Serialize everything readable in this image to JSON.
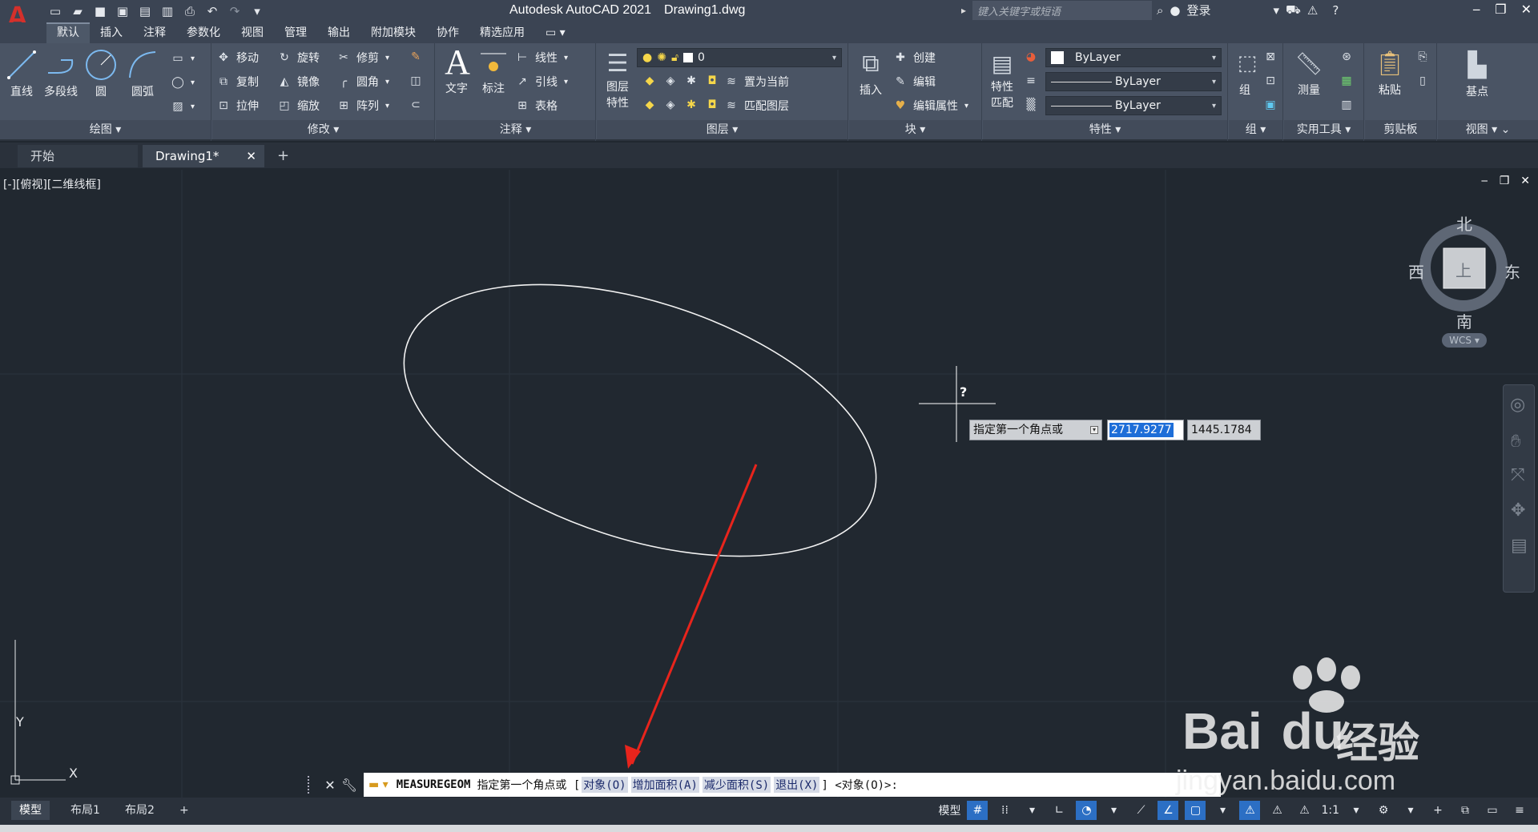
{
  "titlebar": {
    "app_name": "Autodesk AutoCAD 2021",
    "file_name": "Drawing1.dwg",
    "search_placeholder": "键入关键字或短语",
    "login_label": "登录"
  },
  "menu": {
    "tabs": [
      "默认",
      "插入",
      "注释",
      "参数化",
      "视图",
      "管理",
      "输出",
      "附加模块",
      "协作",
      "精选应用"
    ],
    "active": "默认"
  },
  "ribbon": {
    "draw": {
      "title": "绘图",
      "line": "直线",
      "polyline": "多段线",
      "circle": "圆",
      "arc": "圆弧"
    },
    "modify": {
      "title": "修改",
      "move": "移动",
      "rotate": "旋转",
      "trim": "修剪",
      "copy": "复制",
      "mirror": "镜像",
      "fillet": "圆角",
      "stretch": "拉伸",
      "scale": "缩放",
      "array": "阵列"
    },
    "annotation": {
      "title": "注释",
      "text": "文字",
      "dimension": "标注",
      "linear": "线性",
      "leader": "引线",
      "table": "表格"
    },
    "layers": {
      "title": "图层",
      "layer_props_1": "图层",
      "layer_props_2": "特性",
      "current_layer": "0",
      "set_current": "置为当前",
      "match_layer": "匹配图层"
    },
    "block": {
      "title": "块",
      "insert": "插入",
      "create": "创建",
      "edit": "编辑",
      "edit_attr": "编辑属性"
    },
    "properties": {
      "title": "特性",
      "match_1": "特性",
      "match_2": "匹配",
      "color": "ByLayer",
      "linetype": "ByLayer",
      "lineweight": "ByLayer"
    },
    "groups": {
      "title": "组",
      "group": "组"
    },
    "utilities": {
      "title": "实用工具",
      "measure": "测量"
    },
    "clipboard": {
      "title": "剪贴板",
      "paste": "粘贴"
    },
    "view": {
      "title": "视图",
      "base": "基点"
    }
  },
  "doc_tabs": {
    "start": "开始",
    "drawing": "Drawing1*"
  },
  "viewport": {
    "label": "[-][俯视][二维线框]",
    "viewcube": {
      "north": "北",
      "south": "南",
      "east": "东",
      "west": "西",
      "top": "上",
      "wcs": "WCS"
    },
    "ucs": {
      "x": "X",
      "y": "Y"
    }
  },
  "dynamic_input": {
    "prompt": "指定第一个角点或",
    "x_value": "2717.9277",
    "y_value": "1445.1784",
    "cursor_badge": "?"
  },
  "command_line": {
    "command": "MEASUREGEOM",
    "prompt": "指定第一个角点或 [",
    "options": [
      "对象(O)",
      "增加面积(A)",
      "减少面积(S)",
      "退出(X)"
    ],
    "suffix": "] <对象(O)>:"
  },
  "layout_tabs": [
    "模型",
    "布局1",
    "布局2"
  ],
  "status_bar": {
    "model_label": "模型",
    "scale": "1:1"
  },
  "watermark": {
    "brand": "Bai",
    "brand2": "du",
    "sub": "经验",
    "url": "jingyan.baidu.com"
  },
  "colors": {
    "canvas": "#212830",
    "ribbon": "#4a5464",
    "arrow": "#e8241c",
    "highlight": "#1e6ed8"
  }
}
